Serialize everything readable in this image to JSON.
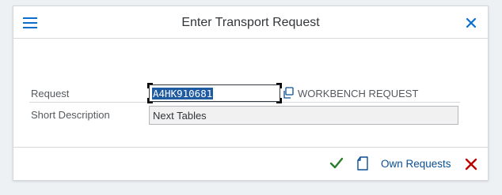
{
  "dialog": {
    "title": "Enter Transport Request"
  },
  "form": {
    "request_label": "Request",
    "request_value": "A4HK910681",
    "request_type": "WORKBENCH REQUEST",
    "short_description_label": "Short Description",
    "short_description_value": "Next Tables"
  },
  "footer": {
    "own_requests_label": "Own Requests"
  },
  "icons": {
    "menu": "hamburger-menu-icon",
    "close": "close-icon",
    "value_help": "value-help-icon",
    "confirm": "checkmark-icon",
    "new": "new-document-icon",
    "cancel": "cancel-icon"
  },
  "colors": {
    "accent": "#0a6ed1",
    "link": "#0a4f94",
    "confirm": "#2b7c2b",
    "cancel": "#bb0000",
    "selection": "#1f5ba0"
  }
}
